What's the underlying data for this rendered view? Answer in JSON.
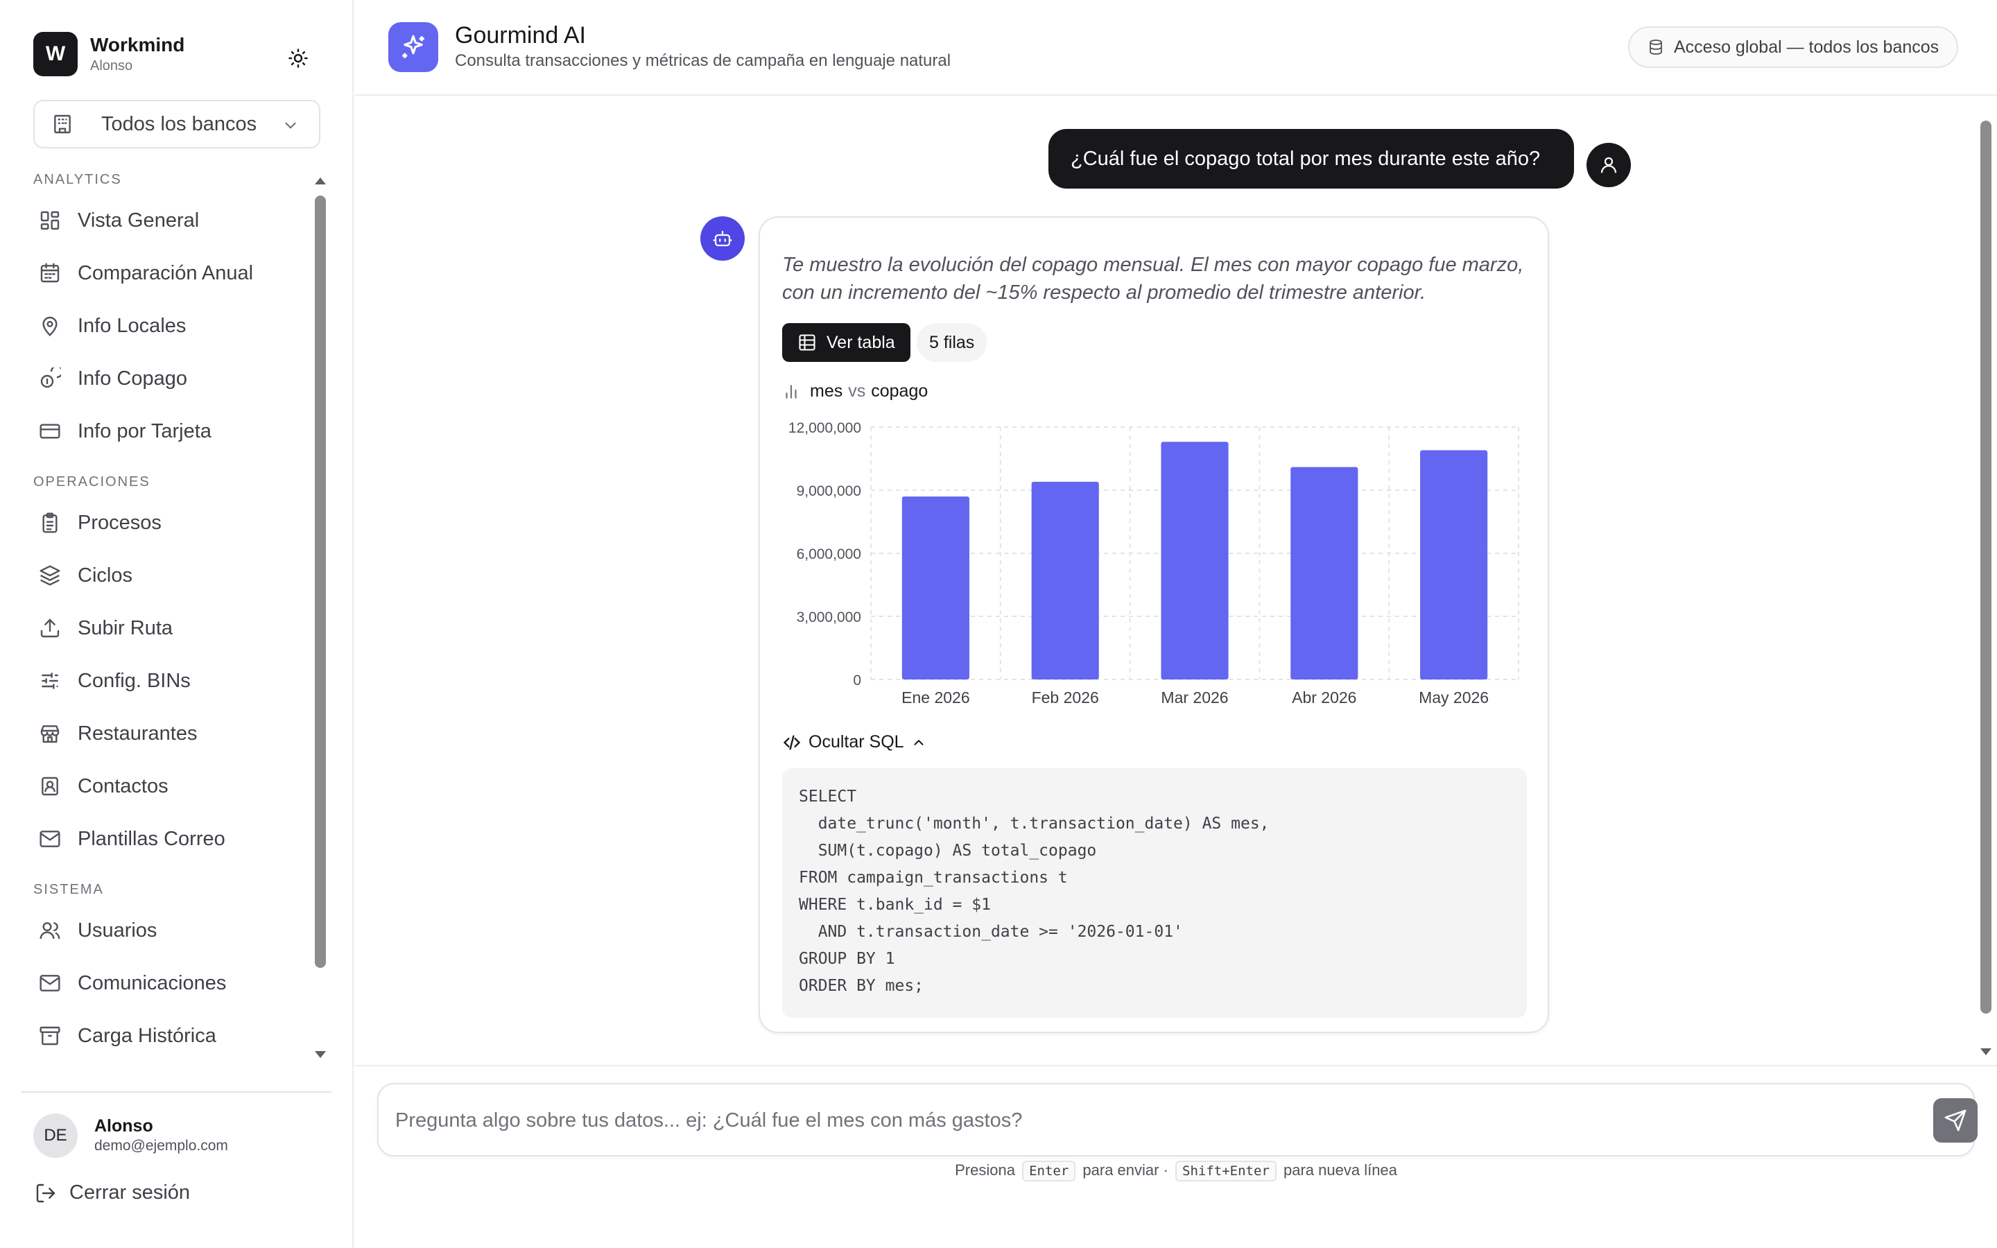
{
  "brand": {
    "initial": "W",
    "name": "Workmind",
    "user": "Alonso"
  },
  "bank_selector": {
    "value": "Todos los bancos"
  },
  "nav": [
    {
      "section": "ANALYTICS",
      "items": [
        {
          "label": "Vista General",
          "icon": "dashboard-icon"
        },
        {
          "label": "Comparación Anual",
          "icon": "calendar-icon"
        },
        {
          "label": "Info Locales",
          "icon": "map-pin-icon"
        },
        {
          "label": "Info Copago",
          "icon": "coins-icon"
        },
        {
          "label": "Info por Tarjeta",
          "icon": "credit-card-icon"
        }
      ]
    },
    {
      "section": "OPERACIONES",
      "items": [
        {
          "label": "Procesos",
          "icon": "clipboard-icon"
        },
        {
          "label": "Ciclos",
          "icon": "layers-icon"
        },
        {
          "label": "Subir Ruta",
          "icon": "upload-icon"
        },
        {
          "label": "Config. BINs",
          "icon": "sliders-icon"
        },
        {
          "label": "Restaurantes",
          "icon": "store-icon"
        },
        {
          "label": "Contactos",
          "icon": "contact-icon"
        },
        {
          "label": "Plantillas Correo",
          "icon": "mail-icon"
        }
      ]
    },
    {
      "section": "SISTEMA",
      "items": [
        {
          "label": "Usuarios",
          "icon": "users-icon"
        },
        {
          "label": "Comunicaciones",
          "icon": "mail-icon"
        },
        {
          "label": "Carga Histórica",
          "icon": "archive-icon"
        }
      ]
    }
  ],
  "account": {
    "initials": "DE",
    "name": "Alonso",
    "email": "demo@ejemplo.com",
    "logout_label": "Cerrar sesión"
  },
  "header": {
    "title": "Gourmind AI",
    "subtitle": "Consulta transacciones y métricas de campaña en lenguaje natural",
    "access_label": "Acceso global — todos los bancos"
  },
  "conversation": {
    "user_message": "¿Cuál fue el copago total por mes durante este año?",
    "assistant_text": "Te muestro la evolución del copago mensual. El mes con mayor copago fue marzo, con un incremento del ~15% respecto al promedio del trimestre anterior.",
    "view_table_label": "Ver tabla",
    "rows_label": "5 filas",
    "chart_x_field": "mes",
    "chart_vs": "vs",
    "chart_y_field": "copago",
    "sql_toggle_label": "Ocultar SQL",
    "sql": "SELECT\n  date_trunc('month', t.transaction_date) AS mes,\n  SUM(t.copago) AS total_copago\nFROM campaign_transactions t\nWHERE t.bank_id = $1\n  AND t.transaction_date >= '2026-01-01'\nGROUP BY 1\nORDER BY mes;"
  },
  "chart_data": {
    "type": "bar",
    "categories": [
      "Ene 2026",
      "Feb 2026",
      "Mar 2026",
      "Abr 2026",
      "May 2026"
    ],
    "values": [
      8700000,
      9400000,
      11300000,
      10100000,
      10900000
    ],
    "ylim": [
      0,
      12000000
    ],
    "yticks": [
      "0",
      "3,000,000",
      "6,000,000",
      "9,000,000",
      "12,000,000"
    ],
    "bar_color": "#6366f1",
    "grid": true
  },
  "composer": {
    "placeholder": "Pregunta algo sobre tus datos... ej: ¿Cuál fue el mes con más gastos?",
    "hint_prefix": "Presiona",
    "hint_key1": "Enter",
    "hint_mid": "para enviar ·",
    "hint_key2": "Shift+Enter",
    "hint_suffix": "para nueva línea"
  },
  "colors": {
    "accent": "#6366f1",
    "dark": "#18181b"
  }
}
